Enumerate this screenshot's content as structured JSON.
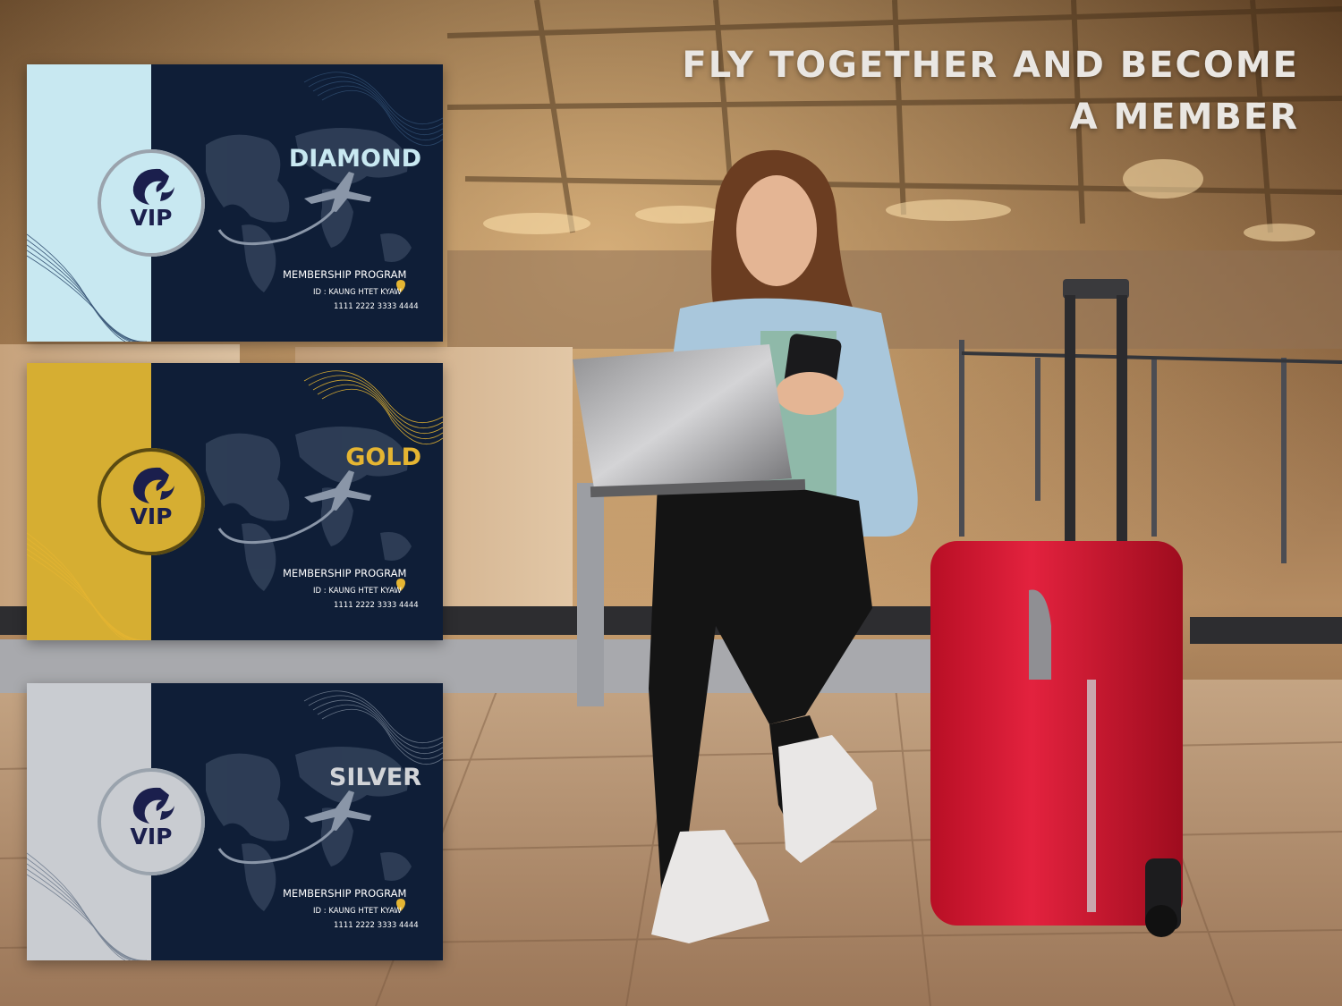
{
  "headline": {
    "line1": "FLY TOGETHER AND BECOME",
    "line2": "A MEMBER"
  },
  "colors": {
    "card_panel": "#0f1e37",
    "vip_text": "#1b1f4d"
  },
  "cards": [
    {
      "tier": "DIAMOND",
      "strip_color": "#c8e8f1",
      "tier_color": "#c8e8f1",
      "badge_label": "VIP",
      "program": "MEMBERSHIP PROGRAM",
      "member_id": "ID : KAUNG HTET KYAW",
      "card_number": "1111 2222 3333 4444",
      "icon": "phoenix-logo-icon"
    },
    {
      "tier": "GOLD",
      "strip_color": "#d6ae32",
      "tier_color": "#e5b532",
      "badge_label": "VIP",
      "program": "MEMBERSHIP PROGRAM",
      "member_id": "ID : KAUNG HTET KYAW",
      "card_number": "1111 2222 3333 4444",
      "icon": "phoenix-logo-icon"
    },
    {
      "tier": "SILVER",
      "strip_color": "#c9ccd1",
      "tier_color": "#d2d4d8",
      "badge_label": "VIP",
      "program": "MEMBERSHIP PROGRAM",
      "member_id": "ID : KAUNG HTET KYAW",
      "card_number": "1111 2222 3333 4444",
      "icon": "phoenix-logo-icon"
    }
  ]
}
